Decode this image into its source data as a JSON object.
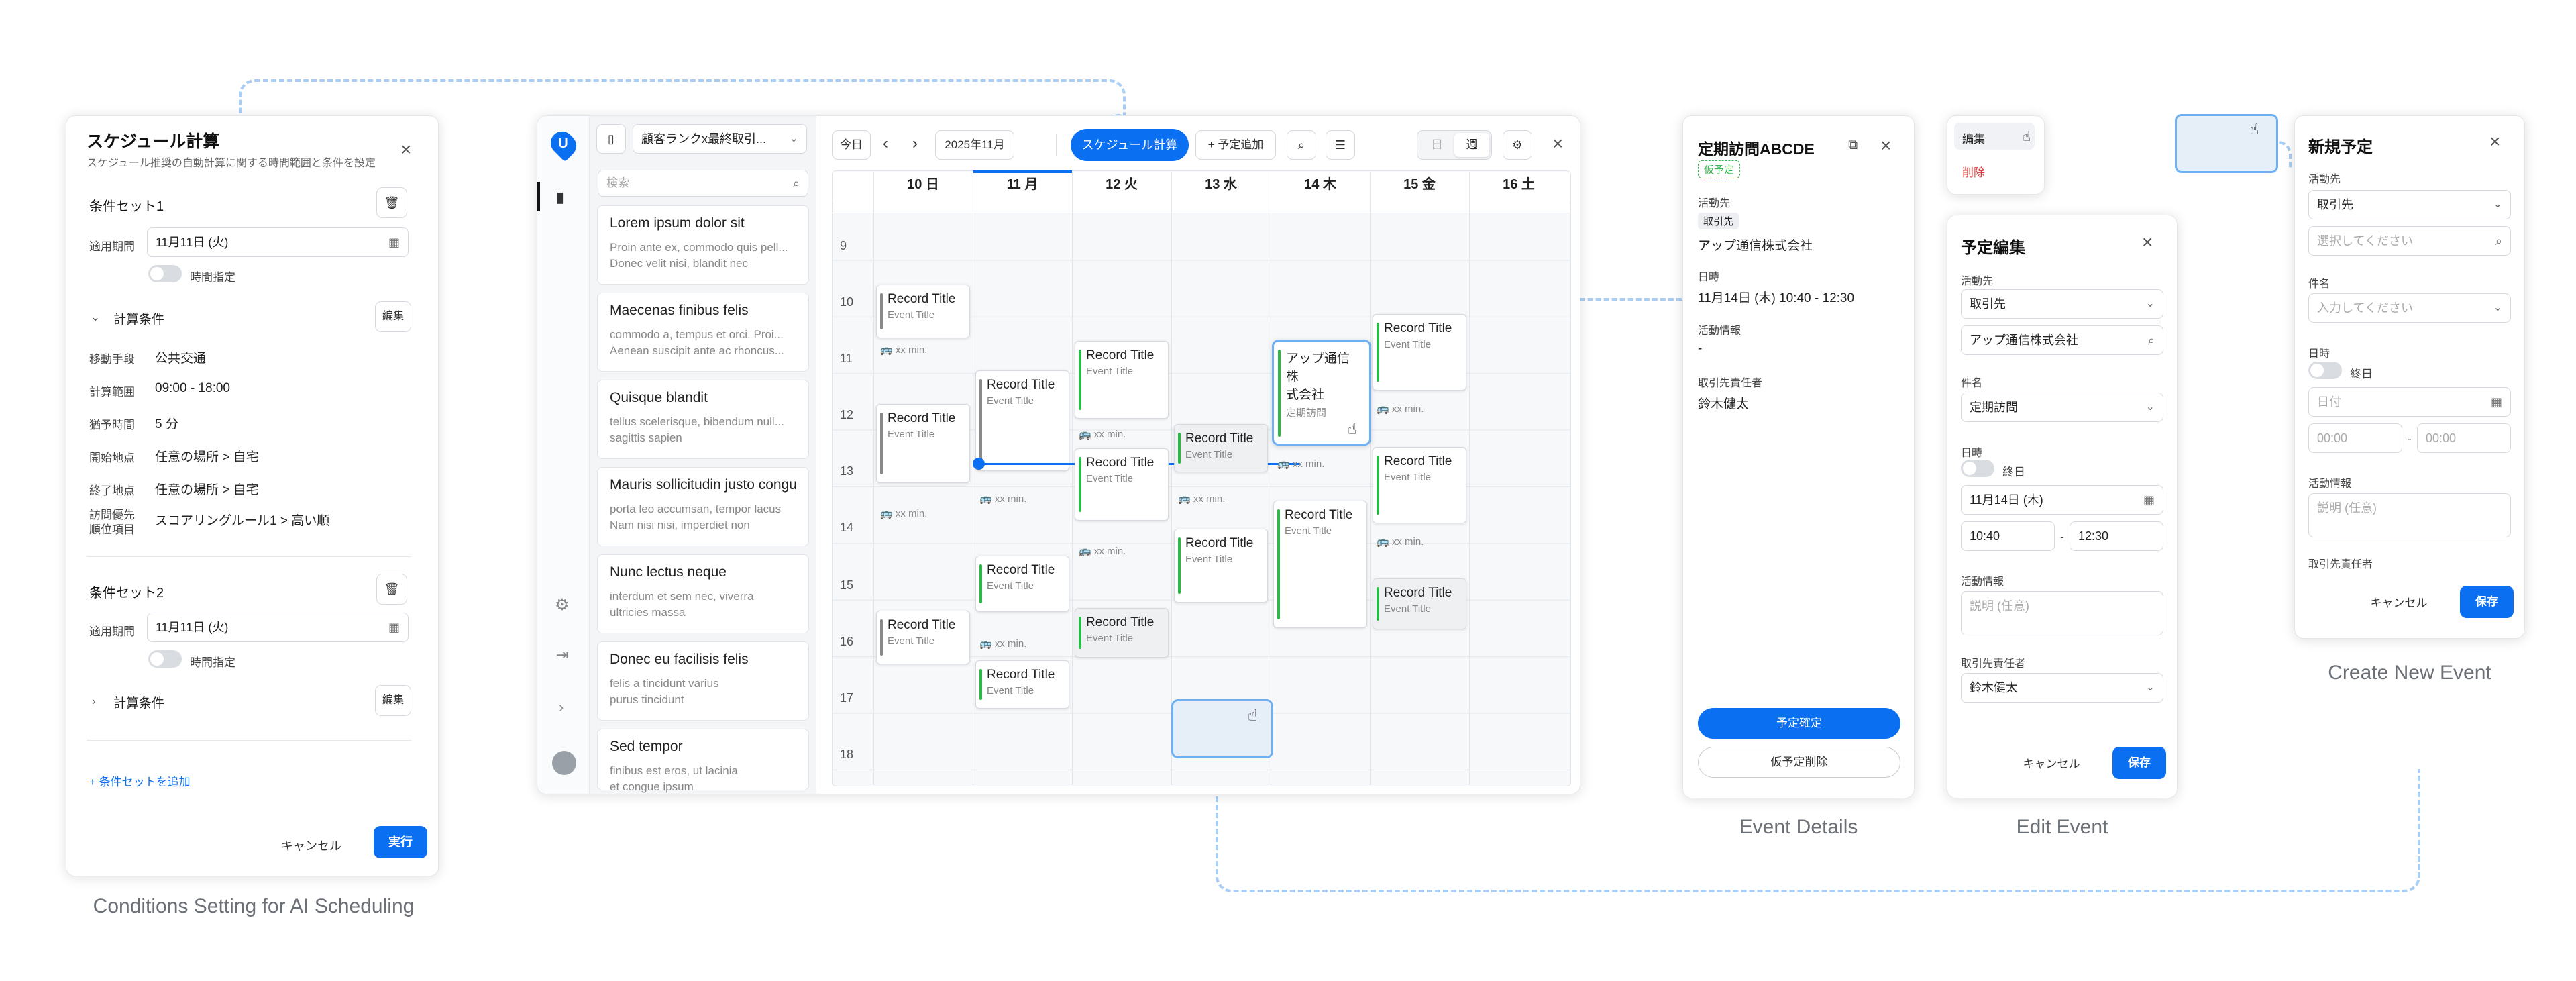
{
  "captions": {
    "conditions": "Conditions Setting for AI Scheduling",
    "details": "Event Details",
    "edit": "Edit Event",
    "create": "Create New Event"
  },
  "conditions": {
    "title": "スケジュール計算",
    "subtitle": "スケジュール推奨の自動計算に関する時間範囲と条件を設定",
    "set1": "条件セット1",
    "period_label": "適用期間",
    "period_value": "11月11日 (火)",
    "time_toggle": "時間指定",
    "calc": "計算条件",
    "edit": "編集",
    "rows": [
      {
        "k": "移動手段",
        "v": "公共交通"
      },
      {
        "k": "計算範囲",
        "v": "09:00 - 18:00"
      },
      {
        "k": "猶予時間",
        "v": "5 分"
      },
      {
        "k": "開始地点",
        "v": "任意の場所 > 自宅"
      },
      {
        "k": "終了地点",
        "v": "任意の場所 > 自宅"
      },
      {
        "k": "訪問優先",
        "k2": "順位項目",
        "v": "スコアリングルール1 > 高い順"
      }
    ],
    "set2": "条件セット2",
    "add": "+ 条件セットを追加",
    "cancel": "キャンセル",
    "run": "実行"
  },
  "calendar": {
    "filter": "顧客ランクx最終取引...",
    "search_placeholder": "検索",
    "today": "今日",
    "month": "2025年11月",
    "schedule_calc": "スケジュール計算",
    "add": "+ 予定追加",
    "view_day": "日",
    "view_week": "週",
    "days": [
      "10 日",
      "11 月",
      "12 火",
      "13 水",
      "14 木",
      "15 金",
      "16 土"
    ],
    "hours": [
      "9",
      "10",
      "11",
      "12",
      "13",
      "14",
      "15",
      "16",
      "17",
      "18"
    ],
    "record_title": "Record Title",
    "event_title": "Event Title",
    "xx": "xx min.",
    "highlight": {
      "title1": "アップ通信株",
      "title2": "式会社",
      "sub": "定期訪問"
    },
    "clients": [
      {
        "a": "Lorem ipsum dolor sit",
        "b1": "Proin ante ex, commodo quis pell...",
        "b2": "Donec velit nisi, blandit nec"
      },
      {
        "a": "Maecenas finibus felis",
        "b1": "commodo a, tempus et orci. Proi...",
        "b2": "Aenean suscipit ante ac rhoncus..."
      },
      {
        "a": "Quisque blandit",
        "b1": "tellus scelerisque, bibendum null...",
        "b2": "sagittis sapien"
      },
      {
        "a": "Mauris sollicitudin justo congue",
        "b1": "porta leo accumsan, tempor lacus",
        "b2": "Nam nisi nisi, imperdiet non"
      },
      {
        "a": "Nunc lectus neque",
        "b1": "interdum et sem nec, viverra",
        "b2": "ultricies massa"
      },
      {
        "a": "Donec eu facilisis felis",
        "b1": "felis a tincidunt varius",
        "b2": "purus tincidunt"
      },
      {
        "a": "Sed tempor",
        "b1": "finibus est eros, ut lacinia",
        "b2": "et congue ipsum"
      }
    ]
  },
  "details": {
    "title": "定期訪問ABCDE",
    "badge": "仮予定",
    "dest_label": "活動先",
    "dest_tag": "取引先",
    "dest_value": "アップ通信株式会社",
    "date_label": "日時",
    "date_value": "11月14日 (木)  10:40 - 12:30",
    "info_label": "活動情報",
    "info_value": "-",
    "person_label": "取引先責任者",
    "person_value": "鈴木健太",
    "confirm": "予定確定",
    "delete": "仮予定削除"
  },
  "menu": {
    "edit": "編集",
    "delete": "削除"
  },
  "edit": {
    "title": "予定編集",
    "dest_label": "活動先",
    "dest_type": "取引先",
    "dest_value": "アップ通信株式会社",
    "subject_label": "件名",
    "subject_value": "定期訪問",
    "date_label": "日時",
    "allday": "終日",
    "date_value": "11月14日 (木)",
    "start": "10:40",
    "end": "12:30",
    "info_label": "活動情報",
    "info_ph": "説明 (任意)",
    "person_label": "取引先責任者",
    "person_value": "鈴木健太",
    "cancel": "キャンセル",
    "save": "保存"
  },
  "create": {
    "title": "新規予定",
    "dest_label": "活動先",
    "dest_type": "取引先",
    "dest_ph": "選択してください",
    "subject_label": "件名",
    "subject_ph": "入力してください",
    "date_label": "日時",
    "allday": "終日",
    "date_ph": "日付",
    "start_ph": "00:00",
    "end_ph": "00:00",
    "info_label": "活動情報",
    "info_ph": "説明 (任意)",
    "person_label": "取引先責任者",
    "cancel": "キャンセル",
    "save": "保存"
  },
  "colors": {
    "primary": "#0a6ff0",
    "green": "#2eb84a",
    "gray": "#888888"
  }
}
